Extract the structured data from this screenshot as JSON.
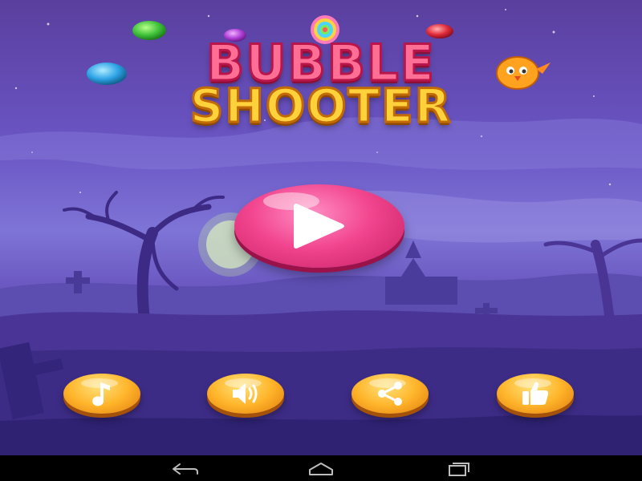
{
  "game": {
    "title_line1": "BUBBLE",
    "title_line2": "SHOOTER",
    "play_button": {
      "icon": "play-icon"
    },
    "menu_buttons": [
      {
        "name": "music",
        "icon": "music-note-icon"
      },
      {
        "name": "sound",
        "icon": "speaker-icon"
      },
      {
        "name": "share",
        "icon": "share-icon"
      },
      {
        "name": "like",
        "icon": "thumbs-up-icon"
      }
    ],
    "decor_bubbles": [
      "green",
      "purple",
      "blue",
      "red",
      "rainbow-lollipop"
    ]
  },
  "nav_bar": {
    "buttons": [
      {
        "name": "back",
        "icon": "back-arrow-icon"
      },
      {
        "name": "home",
        "icon": "home-icon"
      },
      {
        "name": "recents",
        "icon": "recents-icon"
      }
    ]
  },
  "colors": {
    "sky_top": "#5a3f9e",
    "sky_horizon": "#7e74d6",
    "ground": "#3a2a7e",
    "title_pink": "#ff6f95",
    "title_yellow": "#ffd23b",
    "play_pink": "#f2468f",
    "button_orange": "#ffb52b",
    "nav_bar": "#000000"
  }
}
